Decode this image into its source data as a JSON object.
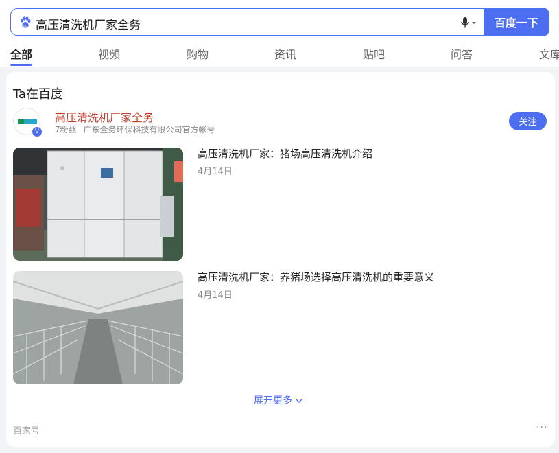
{
  "search": {
    "query": "高压清洗机厂家全务",
    "button_label": "百度一下"
  },
  "tabs": [
    "全部",
    "视频",
    "购物",
    "资讯",
    "贴吧",
    "问答",
    "文库"
  ],
  "card": {
    "title": "Ta在百度",
    "account": {
      "name": "高压清洗机厂家全务",
      "fans": "7粉丝",
      "description": "广东全务环保科技有限公司官方帐号",
      "follow_label": "关注",
      "verified_mark": "V"
    },
    "articles": [
      {
        "title": "高压清洗机厂家：猪场高压清洗机介绍",
        "date": "4月14日"
      },
      {
        "title": "高压清洗机厂家：养猪场选择高压清洗机的重要意义",
        "date": "4月14日"
      }
    ],
    "expand_label": "展开更多",
    "source_label": "百家号",
    "more_label": "···"
  },
  "colors": {
    "accent": "#4e6ef2",
    "account_name": "#c0392b",
    "background": "#f1f3f6"
  }
}
